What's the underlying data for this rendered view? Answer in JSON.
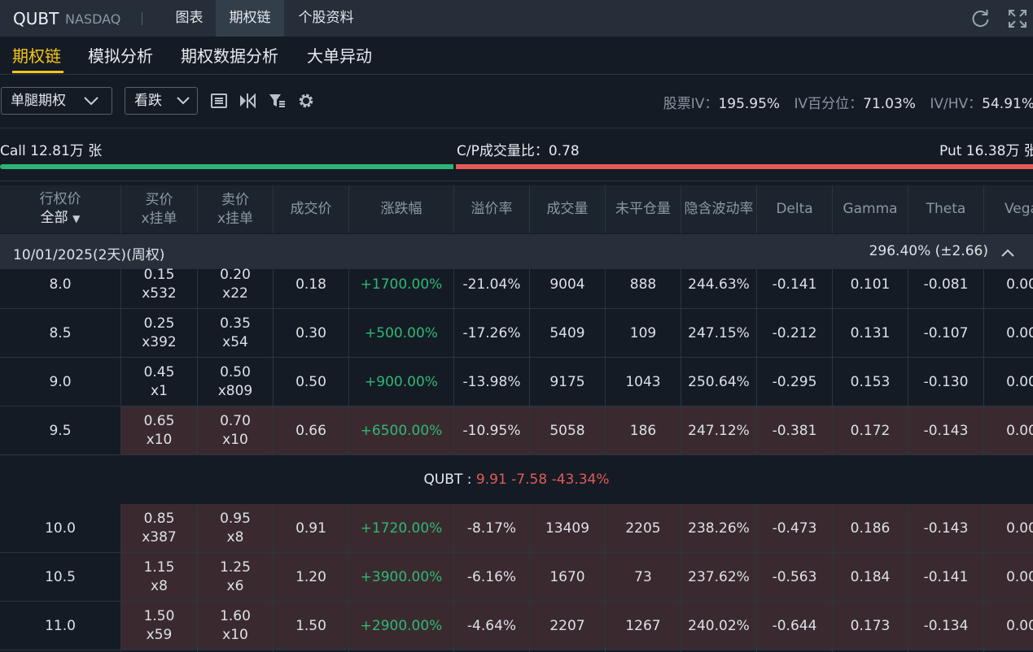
{
  "header": {
    "symbol": "QUBT",
    "exchange": "NASDAQ",
    "tabs": [
      {
        "label": "图表",
        "active": false
      },
      {
        "label": "期权链",
        "active": true
      },
      {
        "label": "个股资料",
        "active": false
      }
    ],
    "icons": [
      "refresh-icon",
      "expand-icon"
    ]
  },
  "subtabs": [
    "期权链",
    "模拟分析",
    "期权数据分析",
    "大单异动"
  ],
  "toolbar": {
    "strategy": "单腿期权",
    "direction": "看跌",
    "icons": [
      "list-icon",
      "compare-icon",
      "filter-icon",
      "settings-icon"
    ],
    "stock_iv_label": "股票IV：",
    "stock_iv": "195.95%",
    "iv_pct_label": "IV百分位：",
    "iv_pct": "71.03%",
    "iv_hv_label": "IV/HV：",
    "iv_hv": "54.91%"
  },
  "ratio": {
    "call": "Call 12.81万 张",
    "cp_label": "C/P成交量比：",
    "cp_value": "0.78",
    "put": "Put 16.38万 张",
    "call_share": 0.439
  },
  "columns": {
    "strike_line1": "行权价",
    "strike_line2": "全部",
    "bid_line1": "买价",
    "bid_line2": "x挂单",
    "ask_line1": "卖价",
    "ask_line2": "x挂单",
    "last": "成交价",
    "change": "涨跌幅",
    "premium": "溢价率",
    "volume": "成交量",
    "oi": "未平仓量",
    "iv": "隐含波动率",
    "delta": "Delta",
    "gamma": "Gamma",
    "theta": "Theta",
    "vega": "Vega"
  },
  "group": {
    "expiry": "10/01/2025(2天)(周权)",
    "iv": "296.40% (±2.66)"
  },
  "rows_above": [
    {
      "strike": "8.0",
      "bid": "0.15",
      "bid_size": "x532",
      "ask": "0.20",
      "ask_size": "x22",
      "last": "0.18",
      "change": "+1700.00%",
      "premium": "-21.04%",
      "volume": "9004",
      "oi": "888",
      "iv": "244.63%",
      "delta": "-0.141",
      "gamma": "0.101",
      "theta": "-0.081",
      "vega": "0.00",
      "itm": false
    },
    {
      "strike": "8.5",
      "bid": "0.25",
      "bid_size": "x392",
      "ask": "0.35",
      "ask_size": "x54",
      "last": "0.30",
      "change": "+500.00%",
      "premium": "-17.26%",
      "volume": "5409",
      "oi": "109",
      "iv": "247.15%",
      "delta": "-0.212",
      "gamma": "0.131",
      "theta": "-0.107",
      "vega": "0.00",
      "itm": false
    },
    {
      "strike": "9.0",
      "bid": "0.45",
      "bid_size": "x1",
      "ask": "0.50",
      "ask_size": "x809",
      "last": "0.50",
      "change": "+900.00%",
      "premium": "-13.98%",
      "volume": "9175",
      "oi": "1043",
      "iv": "250.64%",
      "delta": "-0.295",
      "gamma": "0.153",
      "theta": "-0.130",
      "vega": "0.00",
      "itm": false
    },
    {
      "strike": "9.5",
      "bid": "0.65",
      "bid_size": "x10",
      "ask": "0.70",
      "ask_size": "x10",
      "last": "0.66",
      "change": "+6500.00%",
      "premium": "-10.95%",
      "volume": "5058",
      "oi": "186",
      "iv": "247.12%",
      "delta": "-0.381",
      "gamma": "0.172",
      "theta": "-0.143",
      "vega": "0.00",
      "itm": true
    }
  ],
  "underlying": {
    "symbol": "QUBT :",
    "price": "9.91",
    "change": "-7.58",
    "change_pct": "-43.34%"
  },
  "rows_below": [
    {
      "strike": "10.0",
      "bid": "0.85",
      "bid_size": "x387",
      "ask": "0.95",
      "ask_size": "x8",
      "last": "0.91",
      "change": "+1720.00%",
      "premium": "-8.17%",
      "volume": "13409",
      "oi": "2205",
      "iv": "238.26%",
      "delta": "-0.473",
      "gamma": "0.186",
      "theta": "-0.143",
      "vega": "0.00",
      "itm": true
    },
    {
      "strike": "10.5",
      "bid": "1.15",
      "bid_size": "x8",
      "ask": "1.25",
      "ask_size": "x6",
      "last": "1.20",
      "change": "+3900.00%",
      "premium": "-6.16%",
      "volume": "1670",
      "oi": "73",
      "iv": "237.62%",
      "delta": "-0.563",
      "gamma": "0.184",
      "theta": "-0.141",
      "vega": "0.00",
      "itm": true
    },
    {
      "strike": "11.0",
      "bid": "1.50",
      "bid_size": "x59",
      "ask": "1.60",
      "ask_size": "x10",
      "last": "1.50",
      "change": "+2900.00%",
      "premium": "-4.64%",
      "volume": "2207",
      "oi": "1267",
      "iv": "240.02%",
      "delta": "-0.644",
      "gamma": "0.173",
      "theta": "-0.134",
      "vega": "0.00",
      "itm": true
    }
  ]
}
